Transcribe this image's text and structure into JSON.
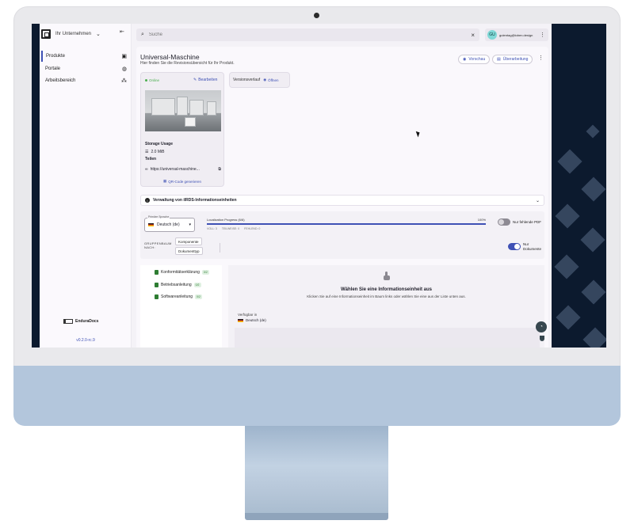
{
  "sidebar": {
    "company": "Ihr Unternehmen",
    "items": [
      {
        "label": "Produkte"
      },
      {
        "label": "Portale"
      },
      {
        "label": "Arbeitsbereich"
      }
    ],
    "logo_text": "EnduraDocs",
    "version": "v0.2.0-rc.9"
  },
  "topbar": {
    "search_placeholder": "Suche",
    "user_initials": "GU",
    "user_email": "gutentag@loben.design"
  },
  "product": {
    "title": "Universal-Maschine",
    "subtitle": "Hier finden Sie die Revisionsübersicht für Ihr Produkt.",
    "preview_button": "Vorschau",
    "revision_button": "Überarbeitung",
    "status": "Online",
    "edit_link": "Bearbeiten",
    "storage_title": "Storage Usage",
    "storage_value": "2.0 MiB",
    "share_title": "Teilen",
    "share_url": "https://universal-maschine...",
    "qr_link": "QR-Code generieren"
  },
  "version_history": {
    "label": "Versionsverlauf",
    "open": "Öffnen"
  },
  "iirds": {
    "label": "Verwaltung von iIRDS-Informationseinheiten"
  },
  "filters": {
    "lang_caption": "Primäre Sprache",
    "lang_value": "Deutsch (de)",
    "progress_label": "Localization Progress (6/6)",
    "progress_percent": "100%",
    "progress_value": 1.0,
    "legend": [
      "VOLL: 3",
      "TEILWEISE: 0",
      "FEHLEND: 0"
    ],
    "missing_pdf_label": "Nur fehlende PDF",
    "missing_pdf_on": false,
    "group_label": "GRUPPENBAUM NACH:",
    "chip_component": "Komponente",
    "chip_doctype": "Dokumenttyp",
    "only_docs_label_1": "Nur",
    "only_docs_label_2": "Dokumente",
    "only_docs_on": true
  },
  "tree": [
    {
      "label": "Konformitätserklärung",
      "badge": "0/2"
    },
    {
      "label": "Betriebsanleitung",
      "badge": "0/2"
    },
    {
      "label": "Softwareanleitung",
      "badge": "0/2"
    }
  ],
  "detail": {
    "title": "Wählen Sie eine Informationseinheit aus",
    "subtitle": "Klicken Sie auf eine Informationseinheit im Baum links oder wählen Sie eine aus der Liste unten aus.",
    "available_label": "Verfügbar in",
    "available_lang": "Deutsch (de)"
  },
  "colors": {
    "accent": "#3f51b5",
    "success": "#4caf50",
    "screen_bg": "#0c1a2e",
    "chin": "#b3c6dc"
  }
}
